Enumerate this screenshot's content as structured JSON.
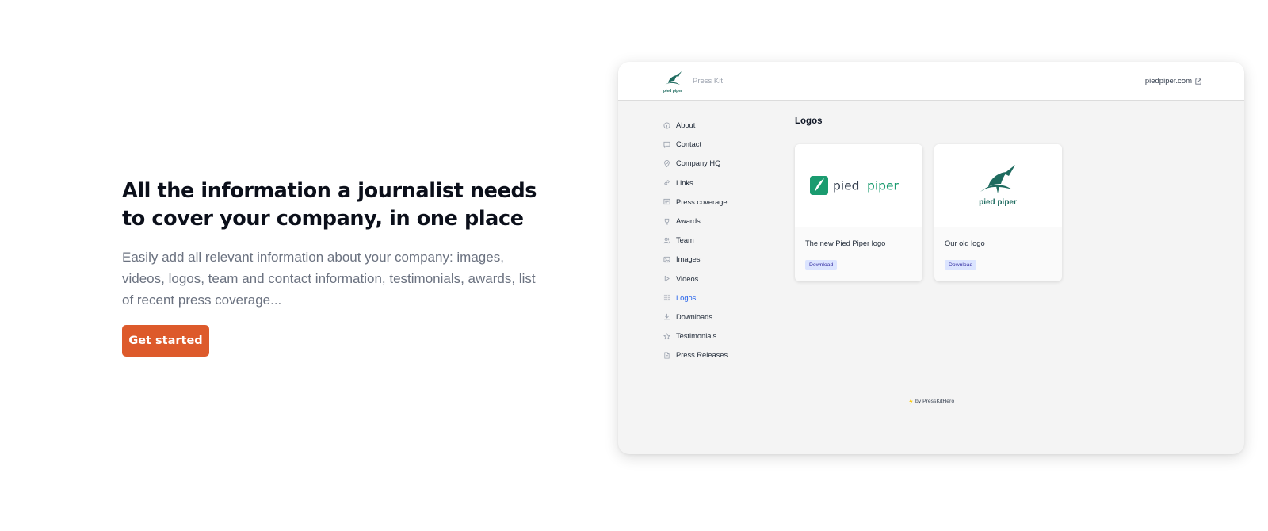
{
  "hero": {
    "heading_line1": "All the information a journalist needs",
    "heading_line2": "to cover your company, in one place",
    "description": "Easily add all relevant information about your company: images, videos, logos, team and contact information, testimonials, awards, list of recent press coverage...",
    "cta_label": "Get started"
  },
  "preview": {
    "brand_wordmark": "pied piper",
    "press_kit_label": "Press Kit",
    "site_link": "piedpiper.com",
    "nav": [
      {
        "label": "About",
        "icon": "info-icon"
      },
      {
        "label": "Contact",
        "icon": "chat-icon"
      },
      {
        "label": "Company HQ",
        "icon": "map-pin-icon"
      },
      {
        "label": "Links",
        "icon": "link-icon"
      },
      {
        "label": "Press coverage",
        "icon": "newspaper-icon"
      },
      {
        "label": "Awards",
        "icon": "trophy-icon"
      },
      {
        "label": "Team",
        "icon": "users-icon"
      },
      {
        "label": "Images",
        "icon": "image-icon"
      },
      {
        "label": "Videos",
        "icon": "play-icon"
      },
      {
        "label": "Logos",
        "icon": "grid-icon",
        "active": true
      },
      {
        "label": "Downloads",
        "icon": "download-icon"
      },
      {
        "label": "Testimonials",
        "icon": "star-icon"
      },
      {
        "label": "Press Releases",
        "icon": "document-icon"
      }
    ],
    "section_title": "Logos",
    "cards": [
      {
        "logo_text_part1": "pied",
        "logo_text_part2": "piper",
        "caption": "The new Pied Piper logo",
        "download_label": "Download"
      },
      {
        "logo_wordmark": "pied piper",
        "caption": "Our old logo",
        "download_label": "Download"
      }
    ],
    "footer_credit": "by PressKitHero"
  },
  "colors": {
    "cta": "#dd5a2b",
    "brand_green": "#1e6b5f",
    "new_logo_green": "#1a9b6f",
    "active_nav": "#2563eb",
    "download_bg": "#dbe4ff"
  }
}
